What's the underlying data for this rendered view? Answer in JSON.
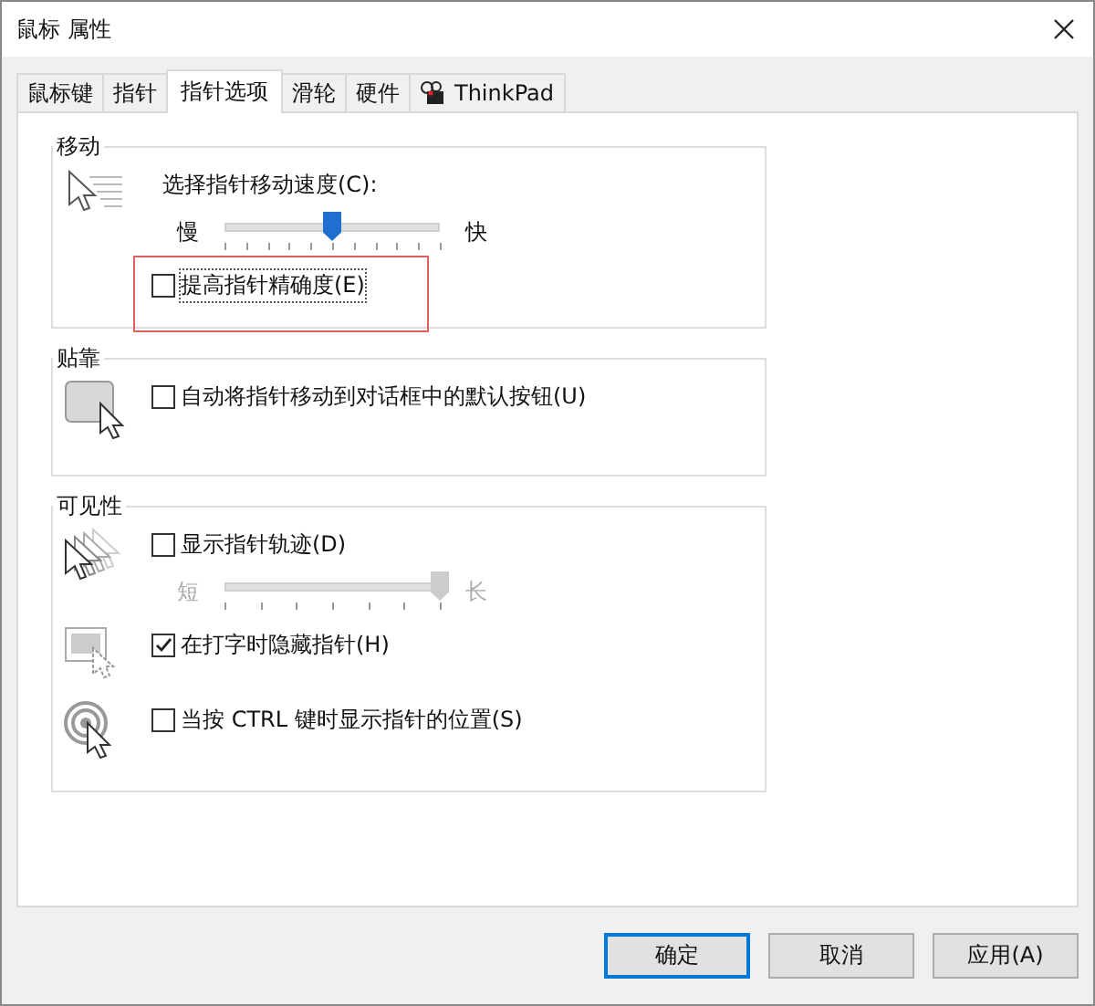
{
  "window": {
    "title": "鼠标 属性"
  },
  "tabs": [
    {
      "label": "鼠标键",
      "selected": false,
      "kind": "text"
    },
    {
      "label": "指针",
      "selected": false,
      "kind": "text"
    },
    {
      "label": "指针选项",
      "selected": true,
      "kind": "text"
    },
    {
      "label": "滑轮",
      "selected": false,
      "kind": "text"
    },
    {
      "label": "硬件",
      "selected": false,
      "kind": "text"
    },
    {
      "label": "ThinkPad",
      "selected": false,
      "kind": "icon"
    }
  ],
  "groups": [
    {
      "title": "移动",
      "rows": [
        {
          "items": [
            {
              "kind": "label",
              "label": "选择指针移动速度(C):"
            },
            {
              "kind": "slider",
              "min_label": "慢",
              "max_label": "快",
              "level": 0.5,
              "disabled": false
            }
          ]
        },
        {
          "items": [
            {
              "kind": "checkbox",
              "label": "提高指针精确度(E)",
              "checked": false,
              "highlighted": true
            }
          ]
        }
      ]
    },
    {
      "title": "贴靠",
      "rows": [
        {
          "items": [
            {
              "kind": "checkbox",
              "label": "自动将指针移动到对话框中的默认按钮(U)",
              "checked": false,
              "highlighted": false
            }
          ]
        }
      ]
    },
    {
      "title": "可见性",
      "rows": [
        {
          "items": [
            {
              "kind": "checkbox",
              "label": "显示指针轨迹(D)",
              "checked": false,
              "highlighted": false
            },
            {
              "kind": "slider",
              "min_label": "短",
              "max_label": "长",
              "level": 1,
              "disabled": true
            }
          ]
        },
        {
          "items": [
            {
              "kind": "checkbox",
              "label": "在打字时隐藏指针(H)",
              "checked": true,
              "highlighted": false
            }
          ]
        },
        {
          "items": [
            {
              "kind": "checkbox",
              "label": "当按 CTRL 键时显示指针的位置(S)",
              "checked": false,
              "highlighted": false
            }
          ]
        }
      ]
    }
  ],
  "buttons": [
    {
      "label": "确定",
      "default": true
    },
    {
      "label": "取消",
      "default": false
    },
    {
      "label": "应用(A)",
      "default": false
    }
  ]
}
